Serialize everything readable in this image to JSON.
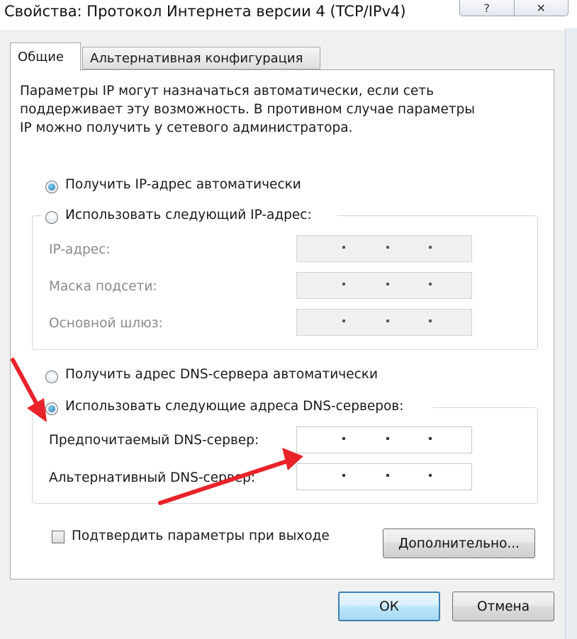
{
  "window": {
    "title": "Свойства: Протокол Интернета версии 4 (TCP/IPv4)",
    "help_glyph": "?",
    "close_glyph": "✕"
  },
  "tabs": [
    {
      "label": "Общие",
      "active": true
    },
    {
      "label": "Альтернативная конфигурация",
      "active": false
    }
  ],
  "intro": {
    "line1": "Параметры IP могут назначаться автоматически, если сеть",
    "line2": "поддерживает эту возможность. В противном случае параметры",
    "line3": "IP можно получить у сетевого администратора."
  },
  "ip_section": {
    "auto_label": "Получить IP-адрес автоматически",
    "auto_checked": true,
    "manual_label": "Использовать следующий IP-адрес:",
    "manual_checked": false,
    "fields": [
      {
        "label": "IP-адрес:",
        "value": ". . ."
      },
      {
        "label": "Маска подсети:",
        "value": ". . ."
      },
      {
        "label": "Основной шлюз:",
        "value": ". . ."
      }
    ]
  },
  "dns_section": {
    "auto_label": "Получить адрес DNS-сервера автоматически",
    "auto_checked": false,
    "manual_label": "Использовать следующие адреса DNS-серверов:",
    "manual_checked": true,
    "fields": [
      {
        "label": "Предпочитаемый DNS-сервер:",
        "value": ". . ."
      },
      {
        "label": "Альтернативный DNS-сервер:",
        "value": ". . ."
      }
    ]
  },
  "validate": {
    "label": "Подтвердить параметры при выходе",
    "checked": false
  },
  "buttons": {
    "advanced": "Дополнительно...",
    "ok": "ОК",
    "cancel": "Отмена"
  },
  "colors": {
    "annotation_arrow": "#e8232a",
    "default_button_border": "#3c7fb1"
  }
}
